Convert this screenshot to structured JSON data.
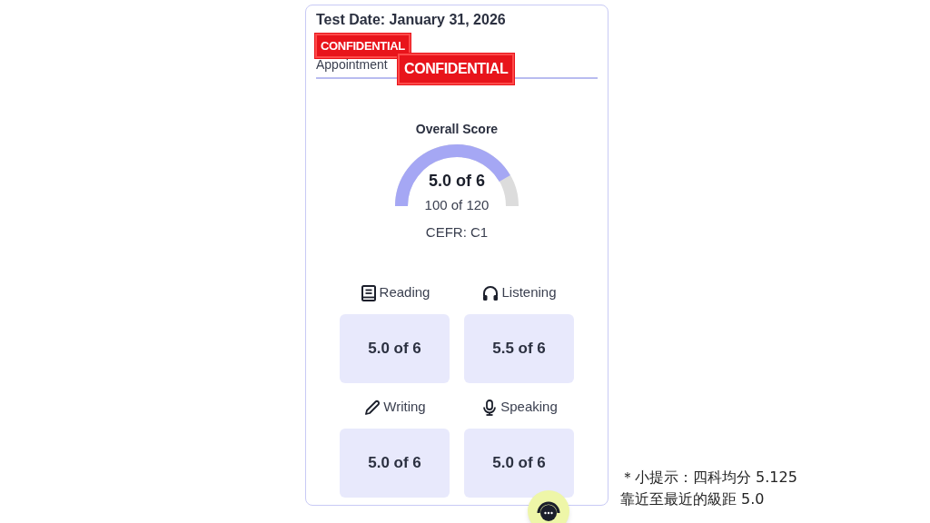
{
  "card": {
    "test_date": "Test Date: January 31, 2026",
    "appointment": "Appointment",
    "stamps": [
      "CONFIDENTIAL",
      "CONFIDENTIAL"
    ]
  },
  "overall": {
    "label": "Overall Score",
    "score": "5.0 of 6",
    "raw": "100 of 120",
    "cefr": "CEFR: C1"
  },
  "sections": [
    {
      "kind": "reading",
      "label": "Reading",
      "score": "5.0 of 6"
    },
    {
      "kind": "listening",
      "label": "Listening",
      "score": "5.5 of 6"
    },
    {
      "kind": "writing",
      "label": "Writing",
      "score": "5.0 of 6"
    },
    {
      "kind": "speaking",
      "label": "Speaking",
      "score": "5.0 of 6"
    }
  ],
  "note": [
    "＊小提示：四科均分 5.125",
    "靠近至最近的級距 5.0"
  ]
}
